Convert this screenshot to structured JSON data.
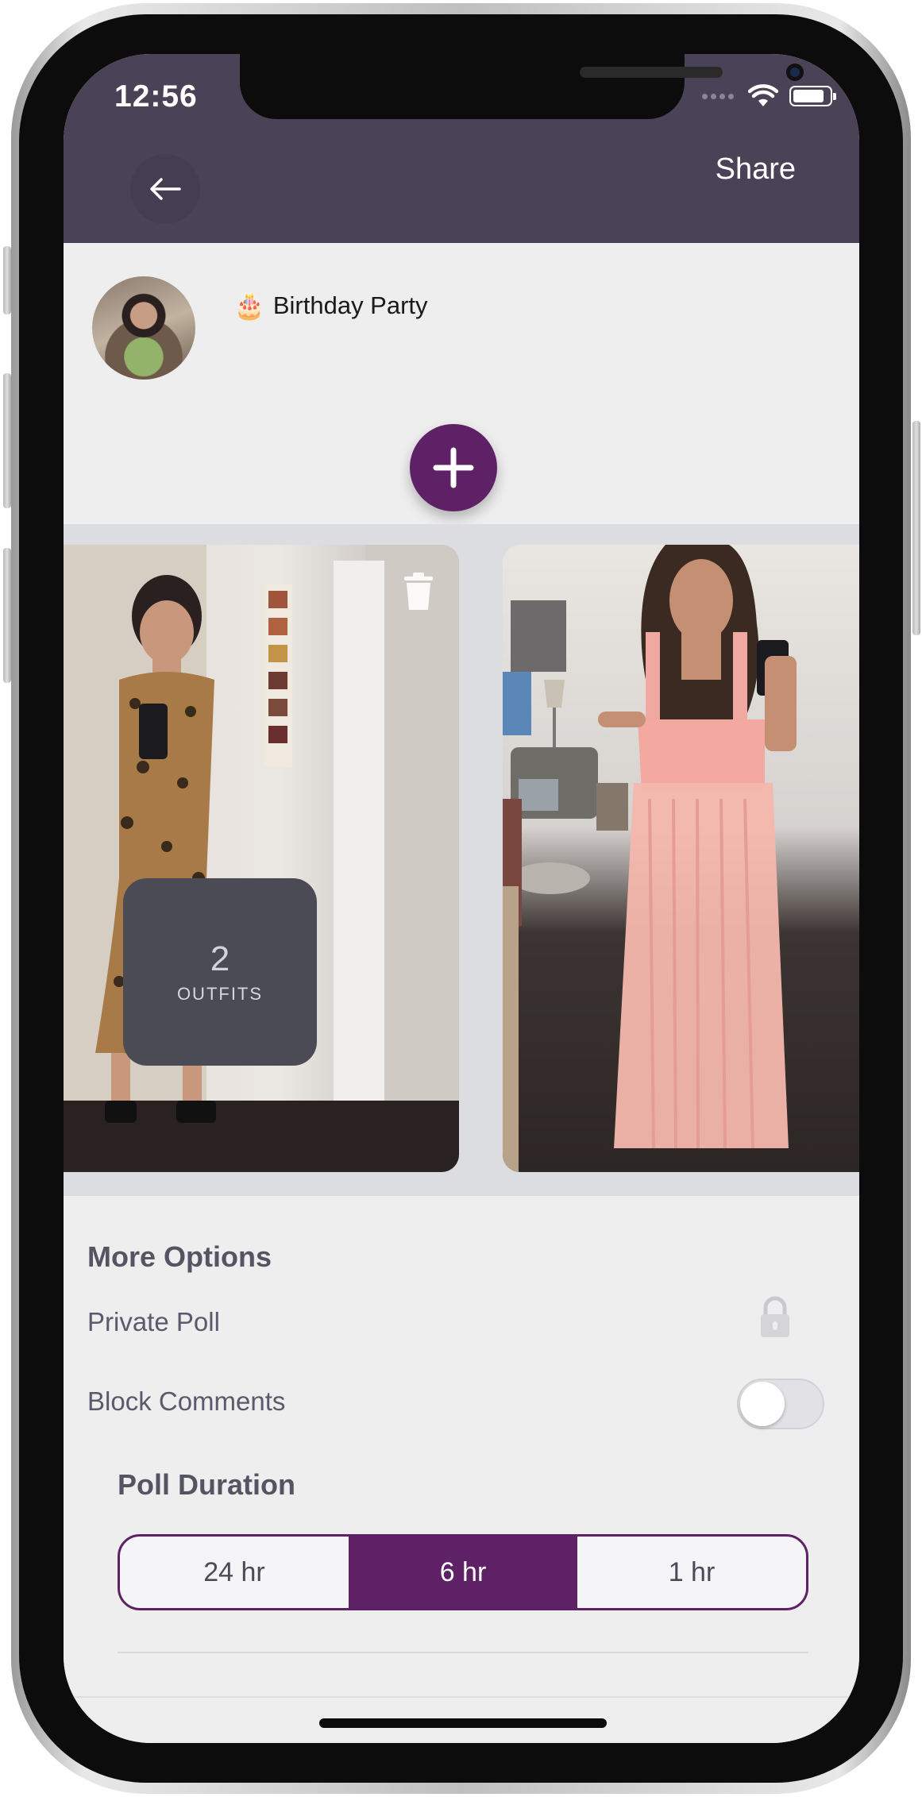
{
  "status_bar": {
    "time": "12:56"
  },
  "header": {
    "share_label": "Share"
  },
  "post": {
    "title_emoji": "🎂",
    "title": "Birthday Party"
  },
  "gallery": {
    "outfit_count": "2",
    "outfit_label": "OUTFITS"
  },
  "more_options": {
    "heading": "More Options",
    "private_poll_label": "Private Poll",
    "block_comments_label": "Block Comments",
    "block_comments_enabled": false
  },
  "poll_duration": {
    "heading": "Poll Duration",
    "options": [
      "24 hr",
      "6 hr",
      "1 hr"
    ],
    "selected": "6 hr"
  },
  "colors": {
    "header": "#4a4257",
    "accent": "#5e2166"
  }
}
